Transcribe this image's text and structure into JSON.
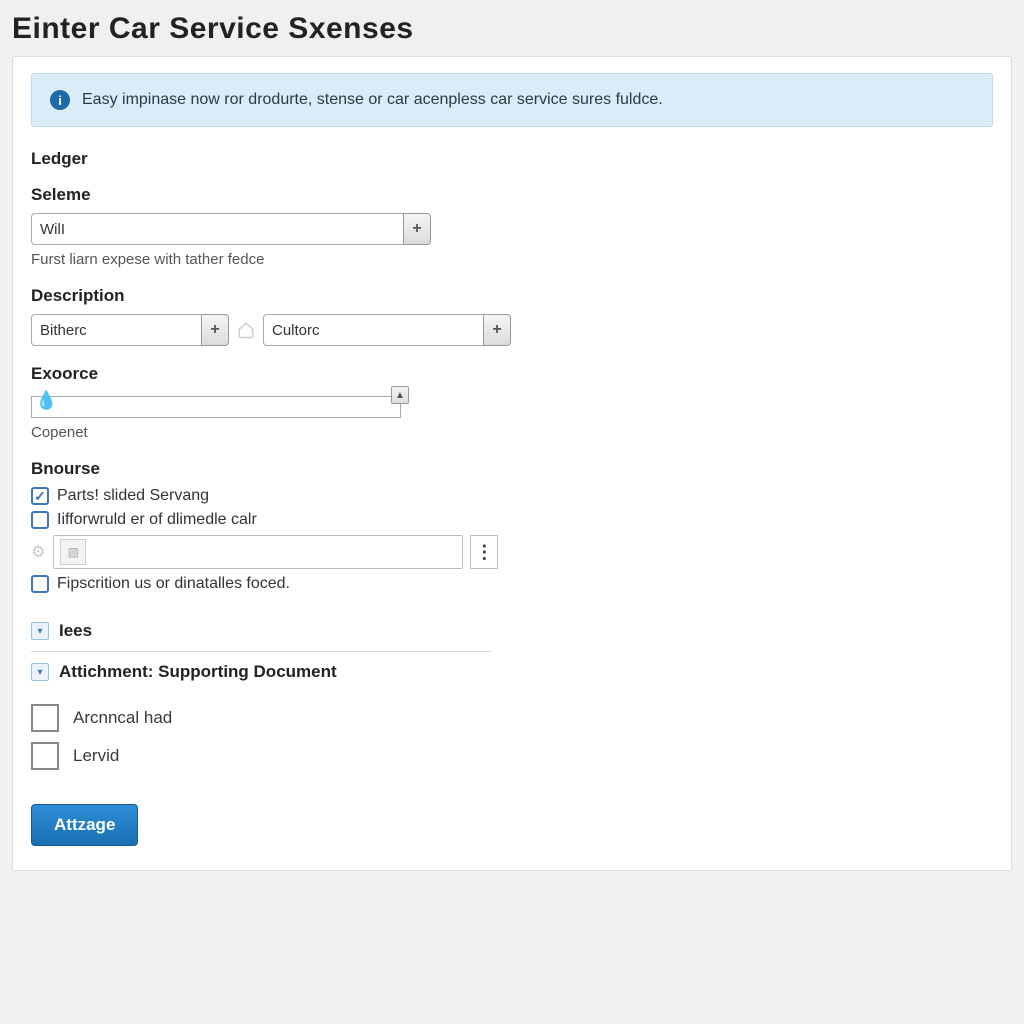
{
  "page_title": "Einter Car Service  Sxenses",
  "info_banner": "Easy impinase now ror drodurte, stense or car acenpless car service sures fuldce.",
  "ledger_label": "Ledger",
  "seleme": {
    "label": "Seleme",
    "value": "WilI",
    "help": "Furst liarn expese with tather fedce"
  },
  "description": {
    "label": "Description",
    "value1": "Bitherc",
    "value2": "Cultorc"
  },
  "exoorce": {
    "label": "Exoorce",
    "value": "",
    "help": "Copenet"
  },
  "bnourse": {
    "label": "Bnourse",
    "opt1": {
      "checked": true,
      "label": "Parts! slided Servang"
    },
    "opt2": {
      "checked": false,
      "label": "Iifforwruld er of dlimedle calr"
    },
    "opt3": {
      "checked": false,
      "label": "Fipscrition us or dinatalles foced."
    }
  },
  "iees_label": "Iees",
  "attachment": {
    "label": "Attichment: Supporting Document",
    "opt1": "Arcnncal had",
    "opt2": "Lervid"
  },
  "submit_label": "Attzage"
}
